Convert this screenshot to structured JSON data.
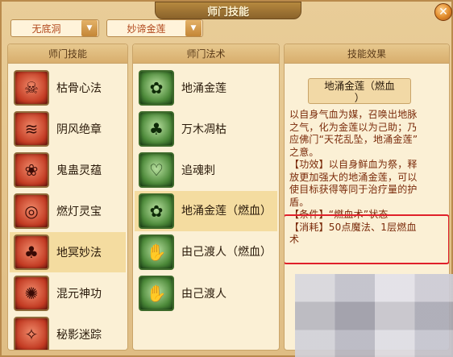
{
  "window": {
    "title": "师门技能",
    "close_label": "✕"
  },
  "filters": [
    {
      "label": "无底洞",
      "arrow": "▼"
    },
    {
      "label": "妙谛金莲",
      "arrow": "▼"
    }
  ],
  "skills_panel": {
    "header": "师门技能",
    "items": [
      {
        "label": "枯骨心法",
        "icon": "skull-meditation-icon",
        "glyph": "☠"
      },
      {
        "label": "阴风绝章",
        "icon": "dark-wind-icon",
        "glyph": "≋"
      },
      {
        "label": "鬼蛊灵蕴",
        "icon": "ghost-worm-icon",
        "glyph": "❀"
      },
      {
        "label": "燃灯灵宝",
        "icon": "lamp-wheel-icon",
        "glyph": "◎"
      },
      {
        "label": "地冥妙法",
        "icon": "earth-tree-icon",
        "glyph": "♣",
        "selected": true
      },
      {
        "label": "混元神功",
        "icon": "chaos-power-icon",
        "glyph": "✺"
      },
      {
        "label": "秘影迷踪",
        "icon": "shadow-trace-icon",
        "glyph": "✧"
      }
    ]
  },
  "spells_panel": {
    "header": "师门法术",
    "items": [
      {
        "label": "地涌金莲",
        "icon": "lotus-icon",
        "glyph": "✿"
      },
      {
        "label": "万木凋枯",
        "icon": "withered-tree-icon",
        "glyph": "♣"
      },
      {
        "label": "追魂刺",
        "icon": "soul-heart-icon",
        "glyph": "♡"
      },
      {
        "label": "地涌金莲（燃血）",
        "icon": "blood-lotus-icon",
        "glyph": "✿",
        "selected": true
      },
      {
        "label": "由己渡人（燃血）",
        "icon": "blood-hand-icon",
        "glyph": "✋"
      },
      {
        "label": "由己渡人",
        "icon": "hand-crossing-icon",
        "glyph": "✋"
      }
    ]
  },
  "effect_panel": {
    "header": "技能效果",
    "skill_name_line1": "地涌金莲（燃血",
    "skill_name_line2": "）",
    "description": [
      "以自身气血为媒，召唤出地脉",
      "之气，化为金莲以为己助；乃",
      "应佛门“天花乱坠，地涌金莲”",
      "之意。",
      "【功效】以自身鲜血为祭，释",
      "放更加强大的地涌金莲，可以",
      "使目标获得等同于治疗量的护",
      "盾。",
      "【条件】“燃血术”状态",
      "【消耗】50点魔法、1层燃血",
      "术"
    ]
  },
  "colors": {
    "accent_red": "#e0202a",
    "text_brown": "#7a2a0a",
    "panel_bg": "#fbf0d5"
  }
}
